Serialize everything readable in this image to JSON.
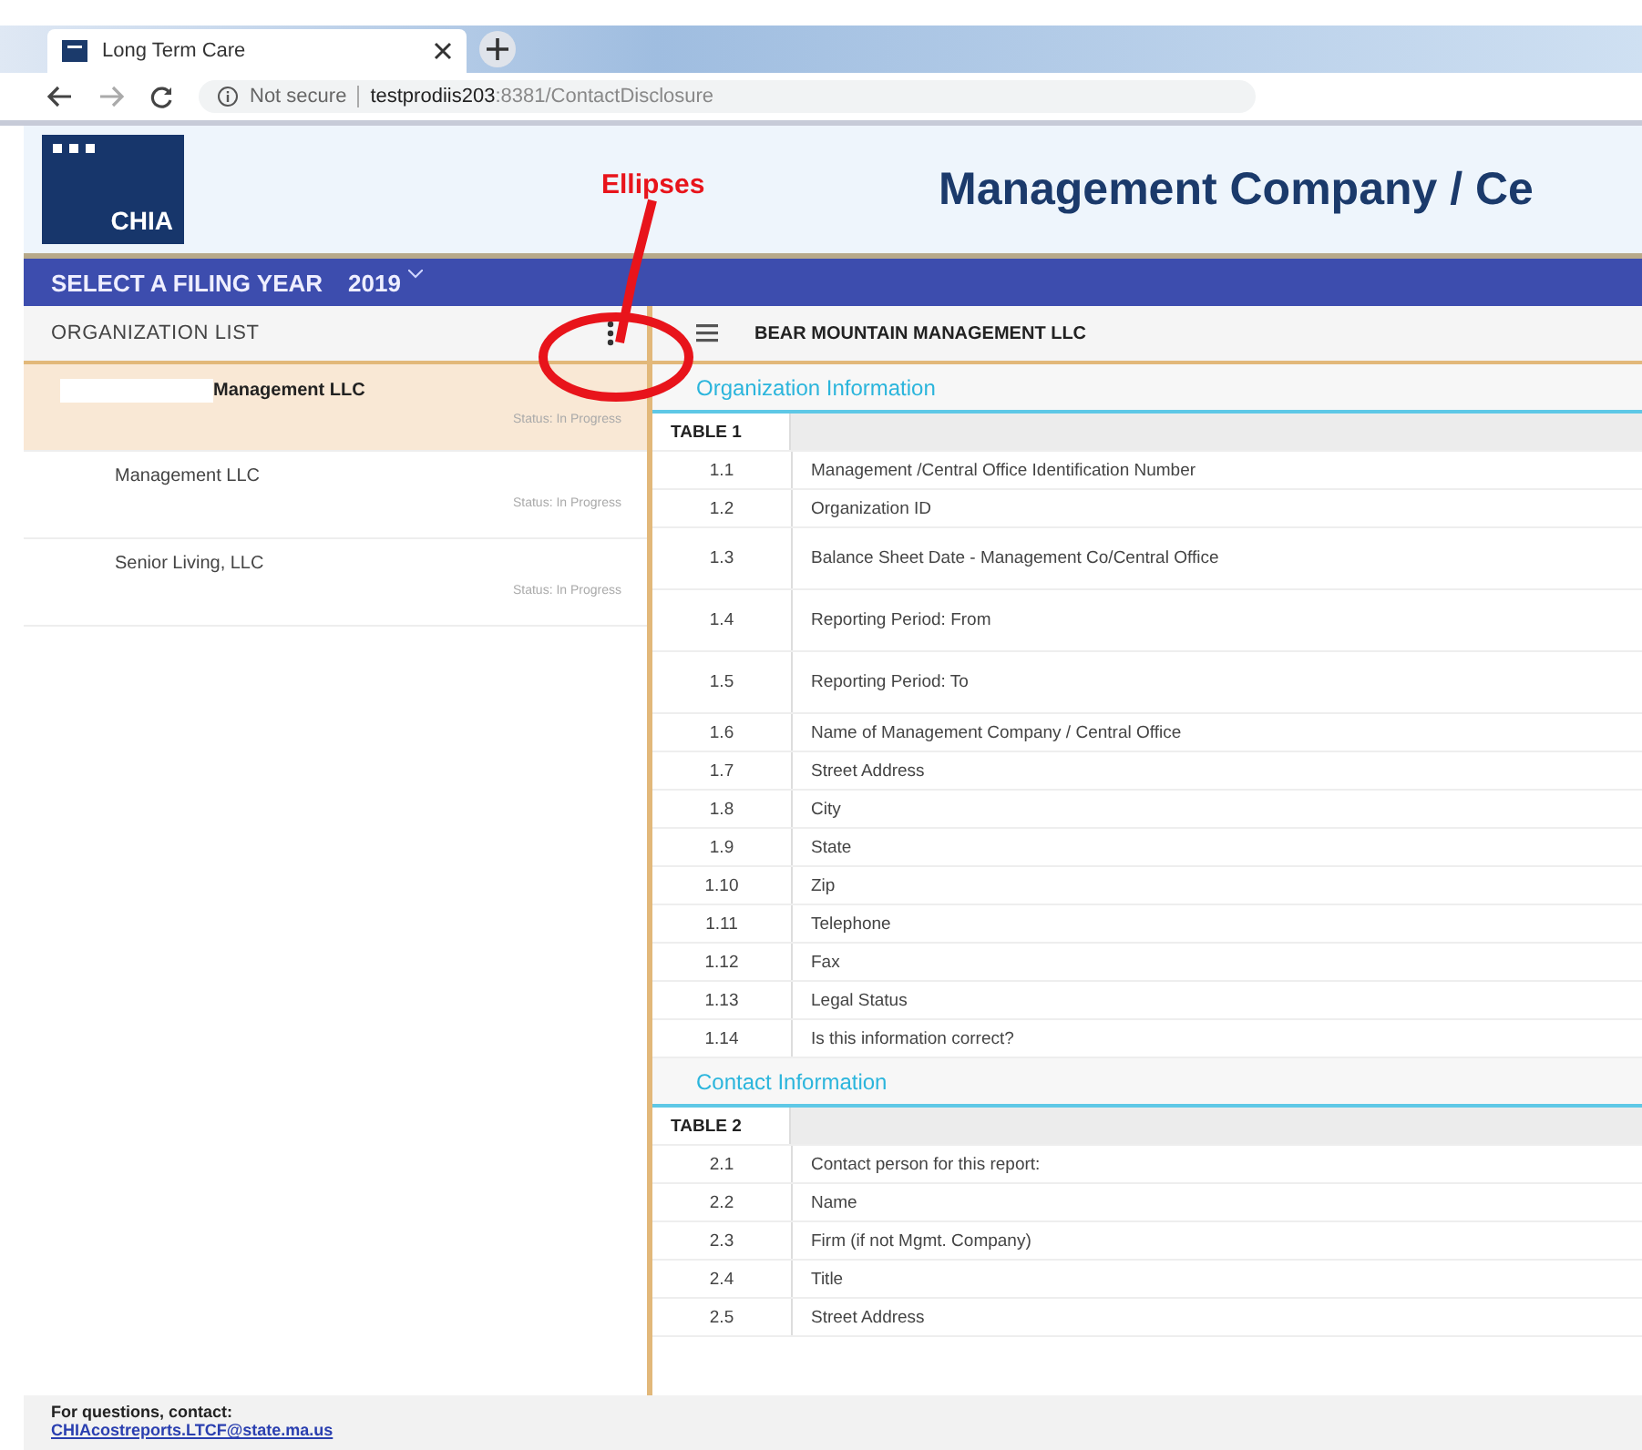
{
  "browser": {
    "tab_title": "Long Term Care",
    "address_security": "Not secure",
    "address_host": "testprodiis203",
    "address_path": ":8381/ContactDisclosure"
  },
  "header": {
    "logo_text": "CHIA",
    "title": "Management Company / Ce"
  },
  "filing_bar": {
    "label": "SELECT A FILING YEAR",
    "year": "2019"
  },
  "sidebar": {
    "title": "ORGANIZATION LIST",
    "items": [
      {
        "name": "Management LLC",
        "status": "Status: In Progress",
        "selected": true,
        "redacted": true
      },
      {
        "name": "Management LLC",
        "status": "Status: In Progress",
        "selected": false,
        "redacted": false
      },
      {
        "name": "Senior Living, LLC",
        "status": "Status: In Progress",
        "selected": false,
        "redacted": false
      }
    ]
  },
  "content": {
    "title": "BEAR MOUNTAIN MANAGEMENT LLC",
    "sections": [
      {
        "heading": "Organization Information",
        "table_label": "TABLE 1",
        "rows": [
          {
            "number": "1.1",
            "label": "Management /Central Office Identification Number",
            "tall": false
          },
          {
            "number": "1.2",
            "label": "Organization ID",
            "tall": false
          },
          {
            "number": "1.3",
            "label": "Balance Sheet Date - Management Co/Central Office",
            "tall": true
          },
          {
            "number": "1.4",
            "label": "Reporting Period: From",
            "tall": true
          },
          {
            "number": "1.5",
            "label": "Reporting Period: To",
            "tall": true
          },
          {
            "number": "1.6",
            "label": "Name of Management Company / Central Office",
            "tall": false
          },
          {
            "number": "1.7",
            "label": "Street Address",
            "tall": false
          },
          {
            "number": "1.8",
            "label": "City",
            "tall": false
          },
          {
            "number": "1.9",
            "label": "State",
            "tall": false
          },
          {
            "number": "1.10",
            "label": "Zip",
            "tall": false
          },
          {
            "number": "1.11",
            "label": "Telephone",
            "tall": false
          },
          {
            "number": "1.12",
            "label": "Fax",
            "tall": false
          },
          {
            "number": "1.13",
            "label": "Legal Status",
            "tall": false
          },
          {
            "number": "1.14",
            "label": "Is this information correct?",
            "tall": false
          }
        ]
      },
      {
        "heading": "Contact Information",
        "table_label": "TABLE 2",
        "rows": [
          {
            "number": "2.1",
            "label": "Contact person for this report:",
            "tall": false
          },
          {
            "number": "2.2",
            "label": "Name",
            "tall": false
          },
          {
            "number": "2.3",
            "label": "Firm (if not Mgmt. Company)",
            "tall": false
          },
          {
            "number": "2.4",
            "label": "Title",
            "tall": false
          },
          {
            "number": "2.5",
            "label": "Street Address",
            "tall": false
          }
        ]
      }
    ]
  },
  "footer": {
    "text": "For questions, contact:",
    "email": "CHIAcostreports.LTCF@state.ma.us"
  },
  "annotation": {
    "label": "Ellipses"
  }
}
